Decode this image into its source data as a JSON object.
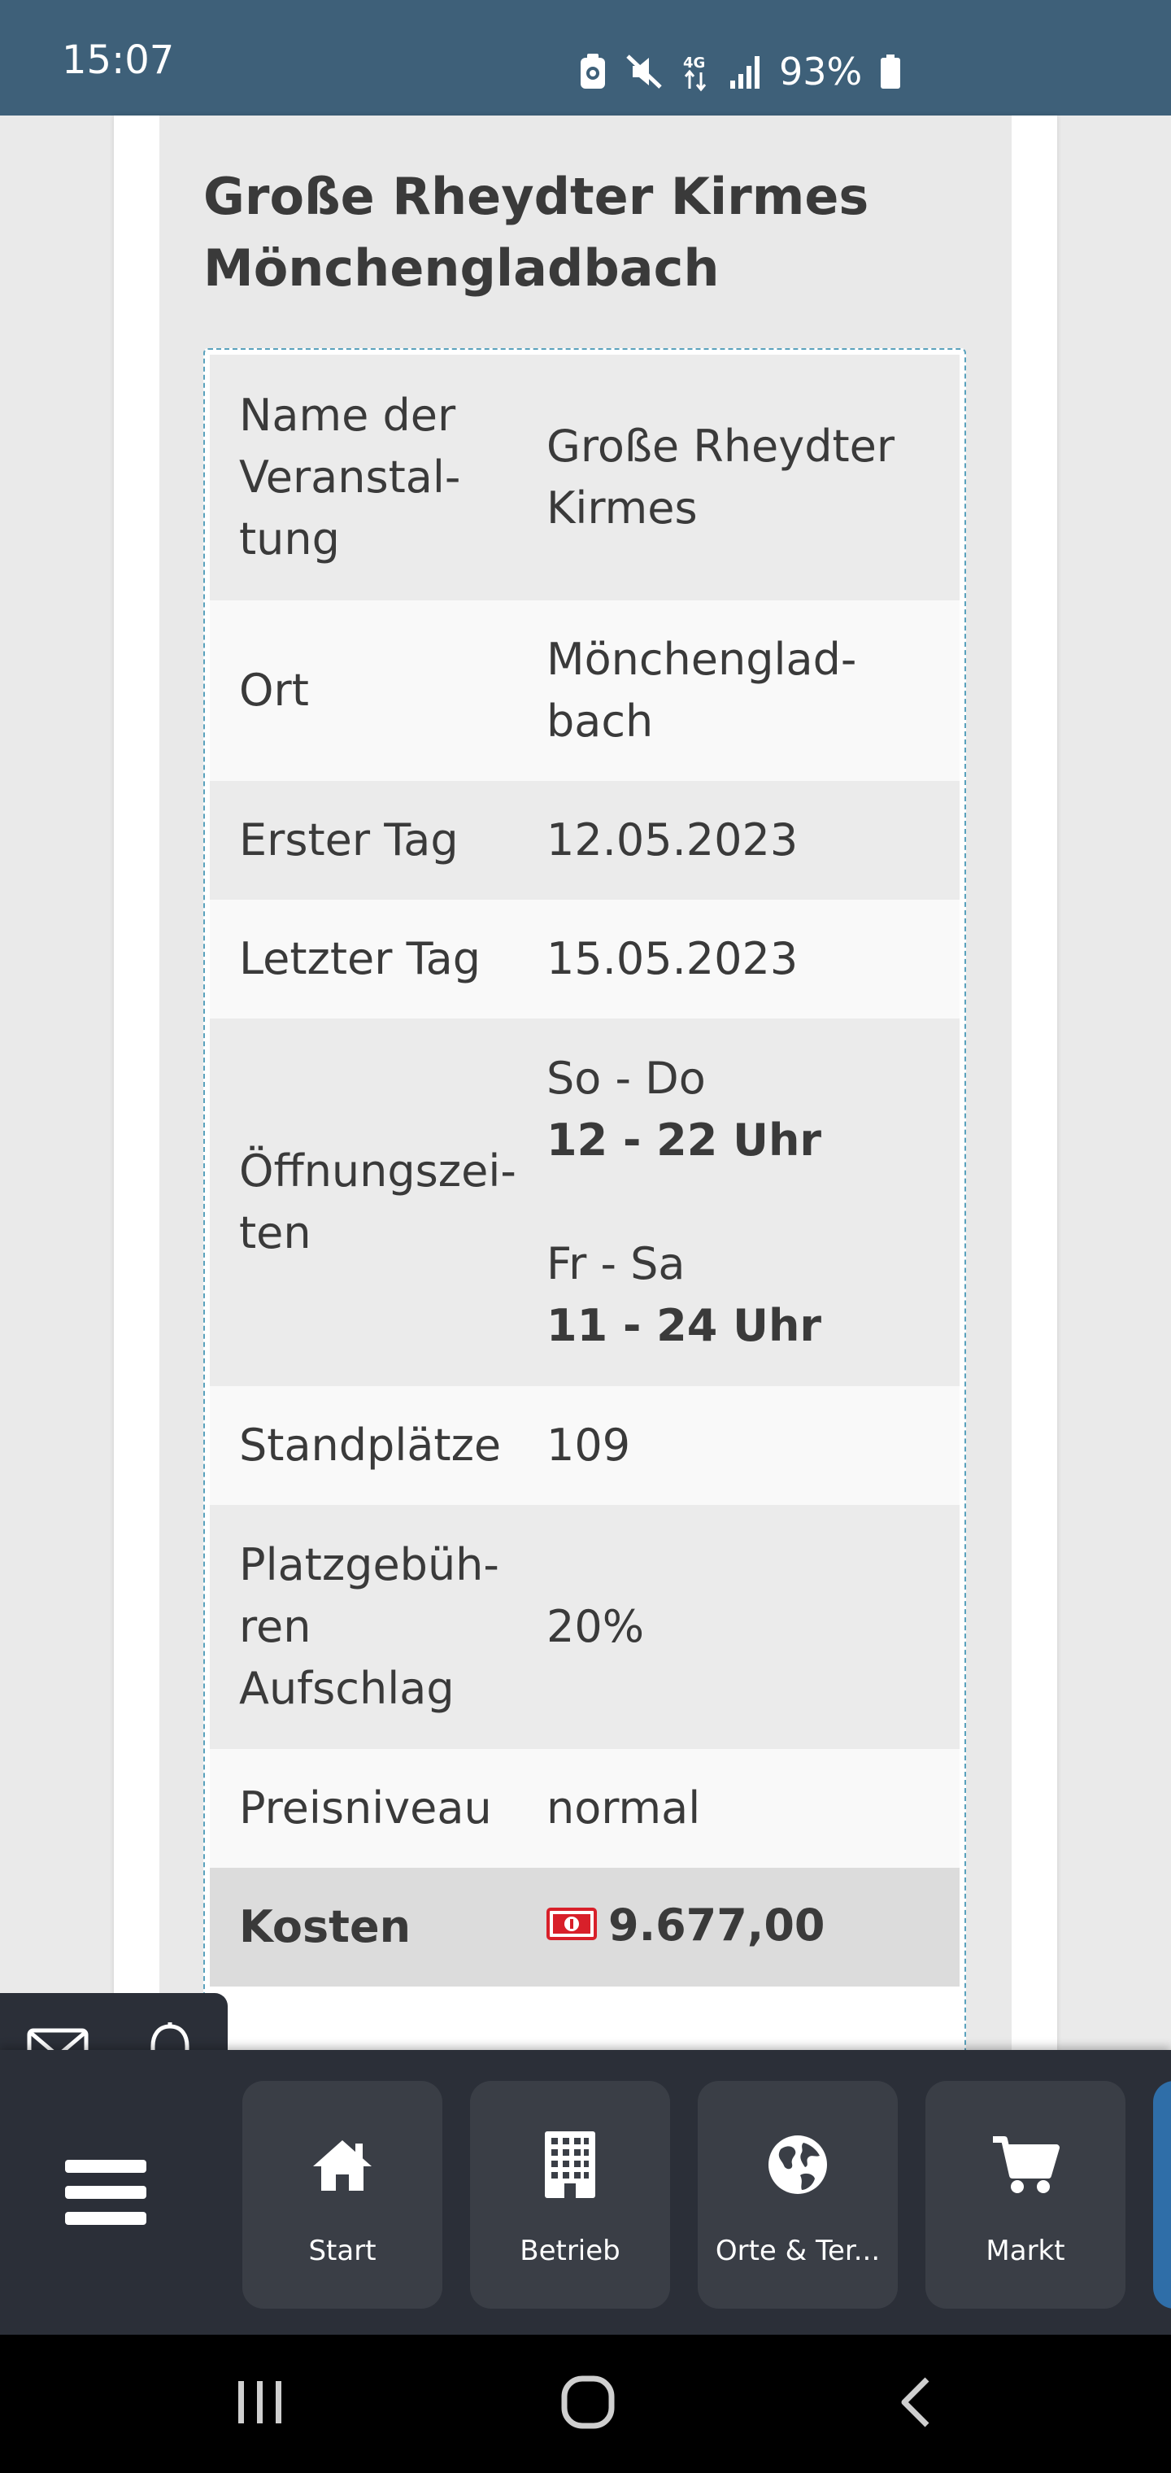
{
  "status_bar": {
    "time": "15:07",
    "battery_text": "93%",
    "icons": [
      "android-system-icon",
      "mute-icon",
      "4g-data-icon",
      "signal-icon",
      "battery-icon"
    ]
  },
  "page": {
    "title_line1": "Große Rheydter Kirmes",
    "title_line2": "Mönchengladbach"
  },
  "details": {
    "name_label": [
      "Name der",
      "Veranstal-",
      "tung"
    ],
    "name_value": [
      "Große Rheydter",
      "Kirmes"
    ],
    "ort_label": "Ort",
    "ort_value": [
      "Mönchenglad-",
      "bach"
    ],
    "erster_tag_label": "Erster Tag",
    "erster_tag_value": "12.05.2023",
    "letzter_tag_label": "Letzter Tag",
    "letzter_tag_value": "15.05.2023",
    "oeffnungszeiten_label": [
      "Öffnungszei-",
      "ten"
    ],
    "oeffnungszeiten": [
      {
        "days": "So - Do",
        "hours": "12 - 22 Uhr"
      },
      {
        "days": "Fr - Sa",
        "hours": "11 - 24 Uhr"
      }
    ],
    "standplaetze_label": "Standplätze",
    "standplaetze_value": "109",
    "platzgebuehren_label": [
      "Platzgebüh-",
      "ren",
      "Aufschlag"
    ],
    "platzgebuehren_value": "20%",
    "preisniveau_label": "Preisniveau",
    "preisniveau_value": "normal",
    "kosten_label": "Kosten",
    "kosten_value": "9.677,00"
  },
  "mini_toolbar": {
    "icons": [
      "mail-icon",
      "bell-icon"
    ]
  },
  "bottom_nav": {
    "menu_icon": "hamburger-menu-icon",
    "items": [
      {
        "label": "Start",
        "icon": "home-icon"
      },
      {
        "label": "Betrieb",
        "icon": "building-icon"
      },
      {
        "label": "Orte & Ter...",
        "icon": "globe-icon"
      },
      {
        "label": "Markt",
        "icon": "cart-icon"
      }
    ]
  },
  "colors": {
    "status_bar": "#3e6079",
    "nav_background": "#2b2f38",
    "nav_tile": "#3a3e46",
    "card_border": "#5aa2bd",
    "money_red": "#d8202a",
    "active_tab_blue": "#2f6ea8"
  }
}
